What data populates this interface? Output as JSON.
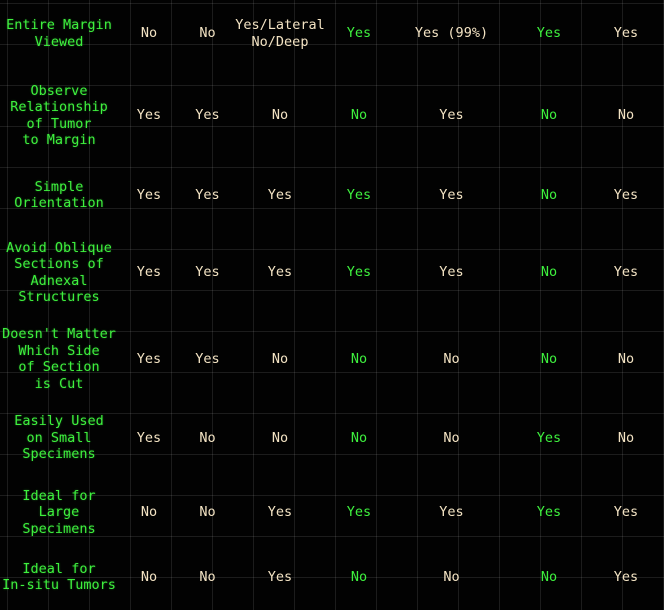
{
  "colors": {
    "background": "#000000",
    "label_green": "#3ef03e",
    "value_white": "#f3e3c3",
    "value_green": "#3ef03e"
  },
  "table": {
    "rows": [
      {
        "label": "Entire Margin\nViewed",
        "cells": [
          {
            "text": "No",
            "color": "white"
          },
          {
            "text": "No",
            "color": "white"
          },
          {
            "text": "Yes/Lateral\nNo/Deep",
            "color": "white"
          },
          {
            "text": "Yes",
            "color": "green"
          },
          {
            "text": "Yes (99%)",
            "color": "white"
          },
          {
            "text": "Yes",
            "color": "green"
          },
          {
            "text": "Yes",
            "color": "white"
          }
        ]
      },
      {
        "label": "Observe\nRelationship\nof Tumor\nto Margin",
        "cells": [
          {
            "text": "Yes",
            "color": "white"
          },
          {
            "text": "Yes",
            "color": "white"
          },
          {
            "text": "No",
            "color": "white"
          },
          {
            "text": "No",
            "color": "green"
          },
          {
            "text": "Yes",
            "color": "white"
          },
          {
            "text": "No",
            "color": "green"
          },
          {
            "text": "No",
            "color": "white"
          }
        ]
      },
      {
        "label": "Simple\nOrientation",
        "cells": [
          {
            "text": "Yes",
            "color": "white"
          },
          {
            "text": "Yes",
            "color": "white"
          },
          {
            "text": "Yes",
            "color": "white"
          },
          {
            "text": "Yes",
            "color": "green"
          },
          {
            "text": "Yes",
            "color": "white"
          },
          {
            "text": "No",
            "color": "green"
          },
          {
            "text": "Yes",
            "color": "white"
          }
        ]
      },
      {
        "label": "Avoid Oblique\nSections of\nAdnexal\nStructures",
        "cells": [
          {
            "text": "Yes",
            "color": "white"
          },
          {
            "text": "Yes",
            "color": "white"
          },
          {
            "text": "Yes",
            "color": "white"
          },
          {
            "text": "Yes",
            "color": "green"
          },
          {
            "text": "Yes",
            "color": "white"
          },
          {
            "text": "No",
            "color": "green"
          },
          {
            "text": "Yes",
            "color": "white"
          }
        ]
      },
      {
        "label": "Doesn't Matter\nWhich Side\nof Section\nis Cut",
        "cells": [
          {
            "text": "Yes",
            "color": "white"
          },
          {
            "text": "Yes",
            "color": "white"
          },
          {
            "text": "No",
            "color": "white"
          },
          {
            "text": "No",
            "color": "green"
          },
          {
            "text": "No",
            "color": "white"
          },
          {
            "text": "No",
            "color": "green"
          },
          {
            "text": "No",
            "color": "white"
          }
        ]
      },
      {
        "label": "Easily Used\non Small\nSpecimens",
        "cells": [
          {
            "text": "Yes",
            "color": "white"
          },
          {
            "text": "No",
            "color": "white"
          },
          {
            "text": "No",
            "color": "white"
          },
          {
            "text": "No",
            "color": "green"
          },
          {
            "text": "No",
            "color": "white"
          },
          {
            "text": "Yes",
            "color": "green"
          },
          {
            "text": "No",
            "color": "white"
          }
        ]
      },
      {
        "label": "Ideal for\nLarge\nSpecimens",
        "cells": [
          {
            "text": "No",
            "color": "white"
          },
          {
            "text": "No",
            "color": "white"
          },
          {
            "text": "Yes",
            "color": "white"
          },
          {
            "text": "Yes",
            "color": "green"
          },
          {
            "text": "Yes",
            "color": "white"
          },
          {
            "text": "Yes",
            "color": "green"
          },
          {
            "text": "Yes",
            "color": "white"
          }
        ]
      },
      {
        "label": "Ideal for\nIn-situ Tumors",
        "cells": [
          {
            "text": "No",
            "color": "white"
          },
          {
            "text": "No",
            "color": "white"
          },
          {
            "text": "Yes",
            "color": "white"
          },
          {
            "text": "No",
            "color": "green"
          },
          {
            "text": "No",
            "color": "white"
          },
          {
            "text": "No",
            "color": "green"
          },
          {
            "text": "Yes",
            "color": "white"
          }
        ]
      }
    ]
  }
}
